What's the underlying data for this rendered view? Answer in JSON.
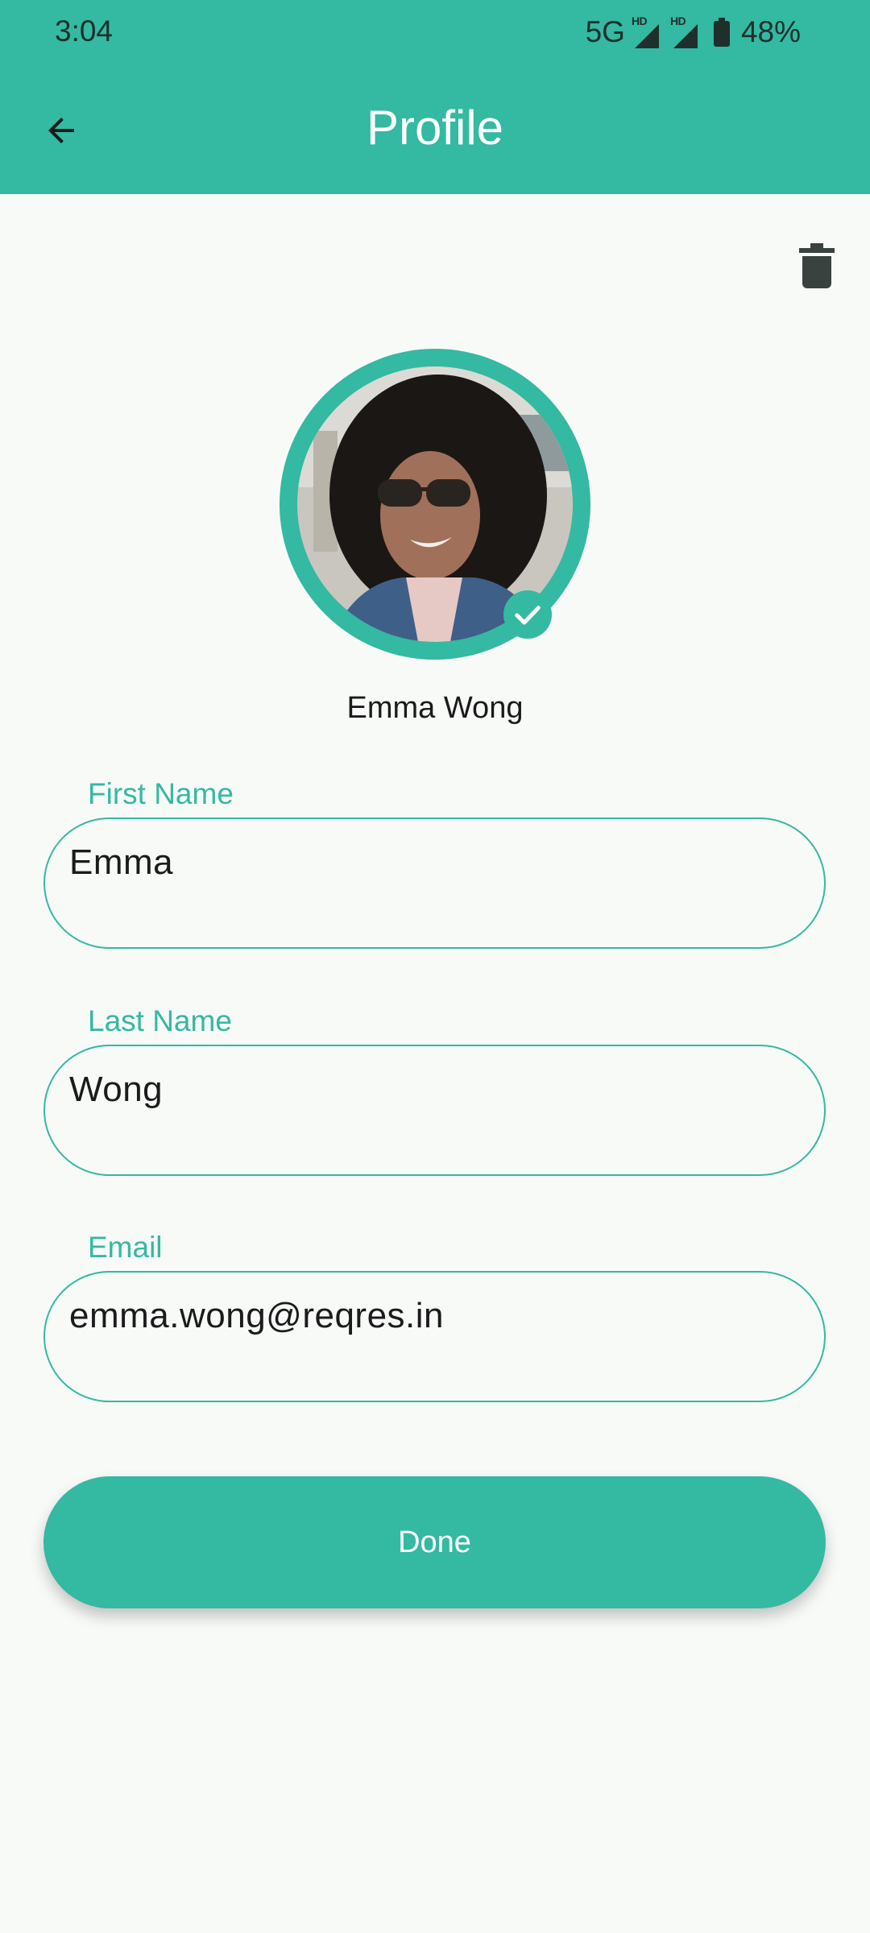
{
  "status_bar": {
    "time": "3:04",
    "network": "5G",
    "sim1_badge": "HD",
    "sim2_badge": "HD",
    "battery_percent": "48%",
    "battery_level": 0.48,
    "icons": [
      "signal-icon",
      "signal-icon",
      "battery-icon"
    ]
  },
  "header": {
    "title": "Profile",
    "back_icon": "arrow-back-icon",
    "delete_icon": "trash-icon"
  },
  "profile": {
    "display_name": "Emma Wong",
    "verified_icon": "check-circle-icon"
  },
  "form": {
    "first_name": {
      "label": "First Name",
      "value": "Emma"
    },
    "last_name": {
      "label": "Last Name",
      "value": "Wong"
    },
    "email": {
      "label": "Email",
      "value": "emma.wong@reqres.in"
    }
  },
  "actions": {
    "done_label": "Done"
  },
  "colors": {
    "accent": "#34b9a2",
    "background": "#f8faf8",
    "text": "#1b1b1b",
    "icon_dark": "#3a4240"
  }
}
